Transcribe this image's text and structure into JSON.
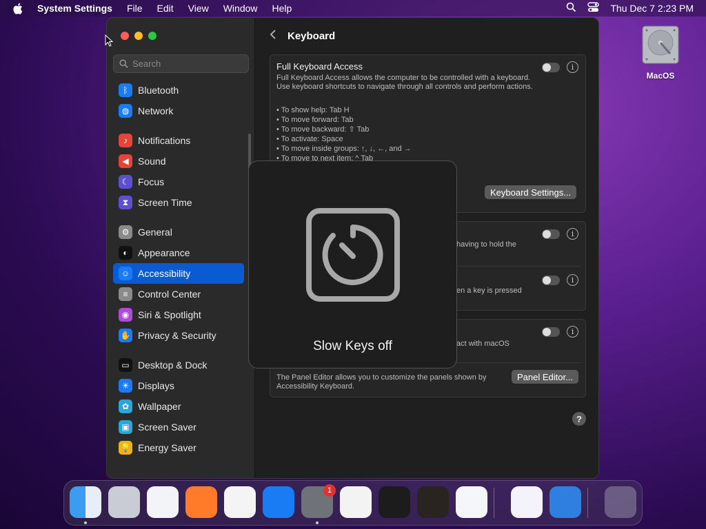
{
  "menubar": {
    "app_name": "System Settings",
    "menus": [
      "File",
      "Edit",
      "View",
      "Window",
      "Help"
    ],
    "clock": "Thu Dec 7  2:23 PM"
  },
  "desktop": {
    "drive_label": "MacOS"
  },
  "sidebar": {
    "search_placeholder": "Search",
    "groups": [
      [
        {
          "label": "Bluetooth",
          "icon": "bluetooth-icon",
          "color": "#1a7cf5"
        },
        {
          "label": "Network",
          "icon": "globe-icon",
          "color": "#1a7cf5"
        }
      ],
      [
        {
          "label": "Notifications",
          "icon": "bell-icon",
          "color": "#e5443a"
        },
        {
          "label": "Sound",
          "icon": "speaker-icon",
          "color": "#e5443a"
        },
        {
          "label": "Focus",
          "icon": "moon-icon",
          "color": "#5e4fd1"
        },
        {
          "label": "Screen Time",
          "icon": "hourglass-icon",
          "color": "#5e4fd1"
        }
      ],
      [
        {
          "label": "General",
          "icon": "gear-icon",
          "color": "#8a8a8a"
        },
        {
          "label": "Appearance",
          "icon": "appearance-icon",
          "color": "#111111"
        },
        {
          "label": "Accessibility",
          "icon": "accessibility-icon",
          "color": "#1a7cf5",
          "active": true
        },
        {
          "label": "Control Center",
          "icon": "switches-icon",
          "color": "#8a8a8a"
        },
        {
          "label": "Siri & Spotlight",
          "icon": "siri-icon",
          "color": "#b04ad8"
        },
        {
          "label": "Privacy & Security",
          "icon": "hand-icon",
          "color": "#1a7cf5"
        }
      ],
      [
        {
          "label": "Desktop & Dock",
          "icon": "dock-icon",
          "color": "#111111"
        },
        {
          "label": "Displays",
          "icon": "sun-icon",
          "color": "#1a7cf5"
        },
        {
          "label": "Wallpaper",
          "icon": "flower-icon",
          "color": "#2aa7d8"
        },
        {
          "label": "Screen Saver",
          "icon": "screensaver-icon",
          "color": "#2aa7d8"
        },
        {
          "label": "Energy Saver",
          "icon": "bulb-icon",
          "color": "#f0b020"
        }
      ]
    ]
  },
  "content": {
    "title": "Keyboard",
    "full_keyboard_access": {
      "title": "Full Keyboard Access",
      "description": "Full Keyboard Access allows the computer to be controlled with a keyboard. Use keyboard shortcuts to navigate through all controls and perform actions.",
      "bullets": [
        "• To show help: Tab H",
        "• To move forward: Tab",
        "• To move backward: ⇧ Tab",
        "• To activate: Space",
        "• To move inside groups: ↑, ↓, ←, and →",
        "• To move to next item: ^ Tab"
      ],
      "settings_button": "Keyboard Settings..."
    },
    "sticky_keys_text": "having to hold the",
    "slow_keys_text": "en a key is pressed",
    "accessibility_keyboard_text": "act with macOS",
    "panel_editor_desc": "The Panel Editor allows you to customize the panels shown by Accessibility Keyboard.",
    "panel_editor_button": "Panel Editor...",
    "help_label": "?",
    "info_label": "i"
  },
  "hud": {
    "message": "Slow Keys off",
    "icon": "timer-icon"
  },
  "dock": {
    "badge_count": "1",
    "apps": [
      {
        "name": "finder-icon"
      },
      {
        "name": "launchpad-icon"
      },
      {
        "name": "safari-icon"
      },
      {
        "name": "firefox-icon"
      },
      {
        "name": "chrome-icon"
      },
      {
        "name": "app-store-icon"
      },
      {
        "name": "system-settings-icon"
      },
      {
        "name": "textedit-icon"
      },
      {
        "name": "terminal-icon"
      },
      {
        "name": "garageband-icon"
      },
      {
        "name": "vscode-icon"
      },
      {
        "name": "visual-studio-icon"
      },
      {
        "name": "weather-icon"
      },
      {
        "name": "trash-icon"
      }
    ]
  }
}
